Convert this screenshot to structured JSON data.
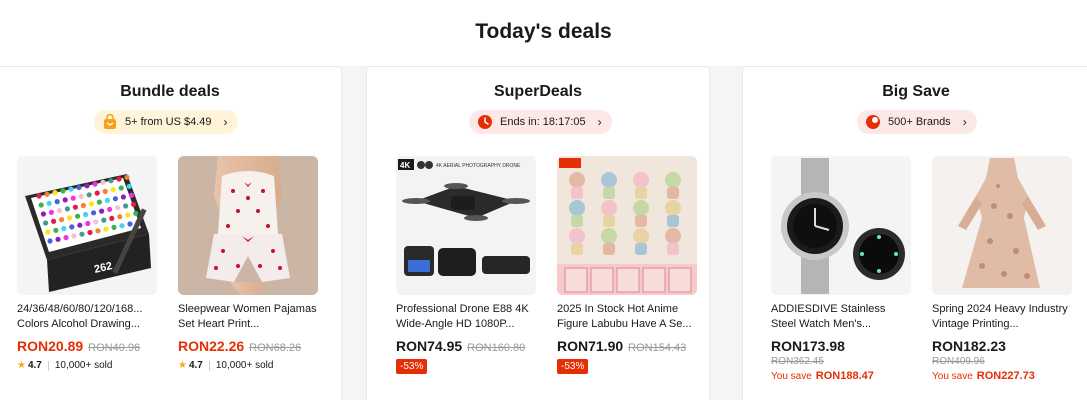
{
  "page": {
    "title": "Today's deals"
  },
  "colors": {
    "accent": "#e62e04",
    "star": "#f5a623"
  },
  "cards": [
    {
      "title": "Bundle deals",
      "pill": {
        "icon": "gift-bag-icon",
        "text": "5+ from US $4.49"
      },
      "products": [
        {
          "name": "24/36/48/60/80/120/168... Colors Alcohol Drawing...",
          "price": "RON20.89",
          "old_price": "RON40.96",
          "rating": "4.7",
          "sold": "10,000+ sold",
          "image": "marker-set-image"
        },
        {
          "name": "Sleepwear Women Pajamas Set Heart Print...",
          "price": "RON22.26",
          "old_price": "RON68.26",
          "rating": "4.7",
          "sold": "10,000+ sold",
          "image": "pajamas-image"
        }
      ]
    },
    {
      "title": "SuperDeals",
      "pill": {
        "icon": "clock-icon",
        "text": "Ends in: 18:17:05"
      },
      "products": [
        {
          "name": "Professional Drone E88 4K Wide-Angle HD 1080P...",
          "price": "RON74.95",
          "old_price": "RON160.80",
          "discount": "-53%",
          "image": "drone-image",
          "image_caption": "4K AERIAL PHOTOGRAPHY DRONE"
        },
        {
          "name": "2025 In Stock Hot Anime Figure Labubu Have A Se...",
          "price": "RON71.90",
          "old_price": "RON154.43",
          "discount": "-53%",
          "image": "figures-image"
        }
      ]
    },
    {
      "title": "Big Save",
      "pill": {
        "icon": "brand-tag-icon",
        "text": "500+ Brands"
      },
      "products": [
        {
          "name": "ADDIESDIVE Stainless Steel Watch Men's...",
          "price": "RON173.98",
          "old_price": "RON362.45",
          "save_label": "You save",
          "save_amount": "RON188.47",
          "image": "watch-image"
        },
        {
          "name": "Spring 2024 Heavy Industry Vintage Printing...",
          "price": "RON182.23",
          "old_price": "RON409.96",
          "save_label": "You save",
          "save_amount": "RON227.73",
          "image": "dress-image"
        }
      ]
    }
  ]
}
